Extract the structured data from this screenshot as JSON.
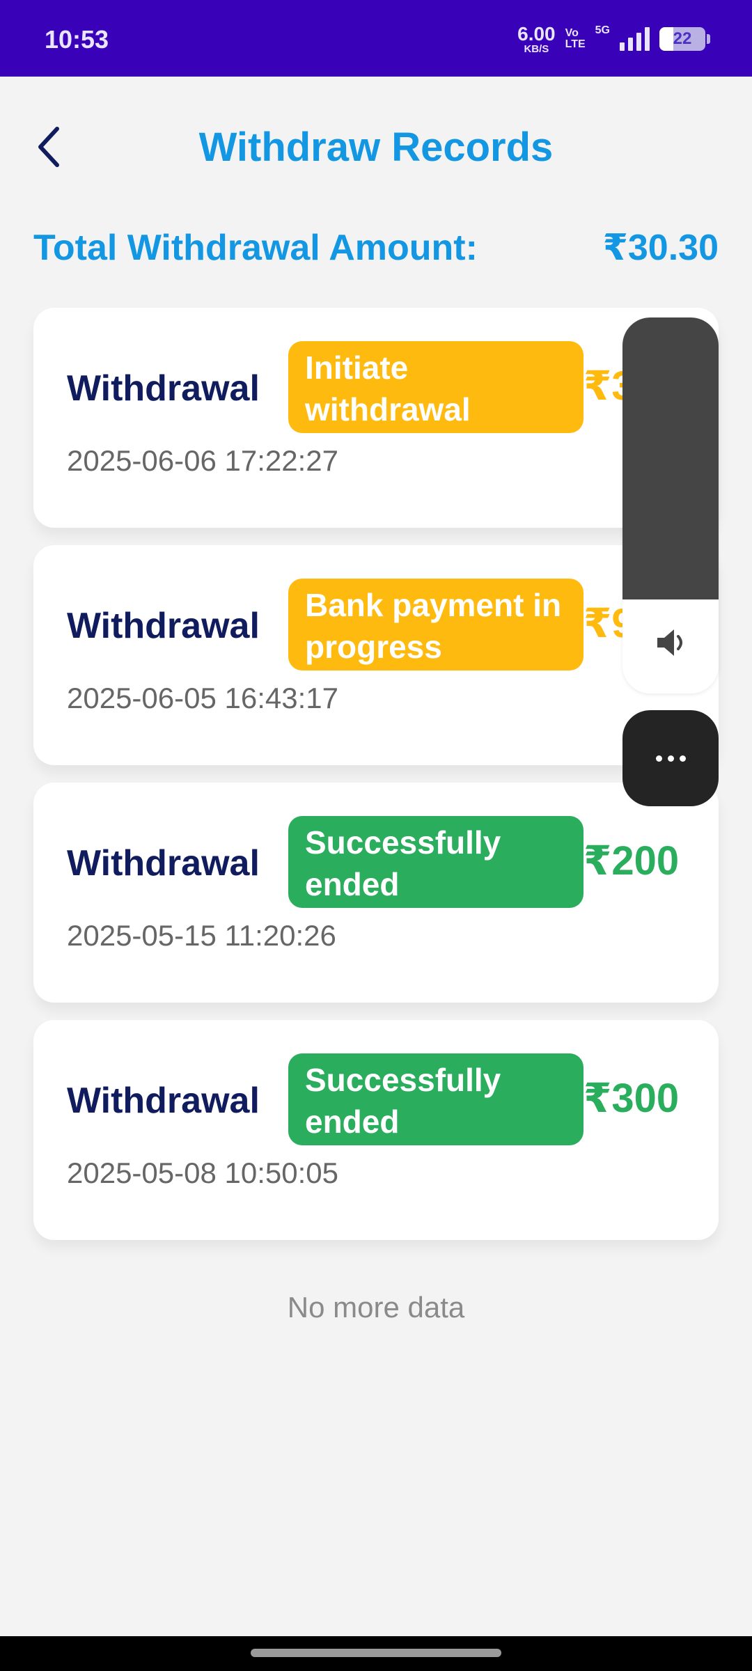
{
  "status_bar": {
    "time": "10:53",
    "net_speed_value": "6.00",
    "net_speed_unit": "KB/S",
    "volte_top": "Vo",
    "volte_bottom": "LTE",
    "network": "5G",
    "battery": "22"
  },
  "header": {
    "back_icon": "chevron-left-icon",
    "title": "Withdraw Records"
  },
  "summary": {
    "label": "Total Withdrawal Amount:",
    "value": "₹30.30"
  },
  "records": [
    {
      "title": "Withdrawal",
      "status": "Initiate withdrawal",
      "status_color": "#ffba0f",
      "amount": "₹300",
      "date": "2025-06-06 17:22:27"
    },
    {
      "title": "Withdrawal",
      "status": "Bank payment in progress",
      "status_color": "#ffba0f",
      "amount": "₹9",
      "date": "2025-06-05 16:43:17"
    },
    {
      "title": "Withdrawal",
      "status": "Successfully ended",
      "status_color": "#2aad5c",
      "amount": "₹200",
      "date": "2025-05-15 11:20:26"
    },
    {
      "title": "Withdrawal",
      "status": "Successfully ended",
      "status_color": "#2aad5c",
      "amount": "₹300",
      "date": "2025-05-08 10:50:05"
    }
  ],
  "footer": {
    "no_more": "No more data"
  },
  "overlays": {
    "volume_icon": "speaker-icon",
    "more_icon": "more-dots-icon"
  },
  "colors": {
    "status_bar": "#3a02b8",
    "title_blue": "#1397e2",
    "navy": "#101c5e",
    "orange": "#ffba0f",
    "green": "#2aad5c"
  }
}
